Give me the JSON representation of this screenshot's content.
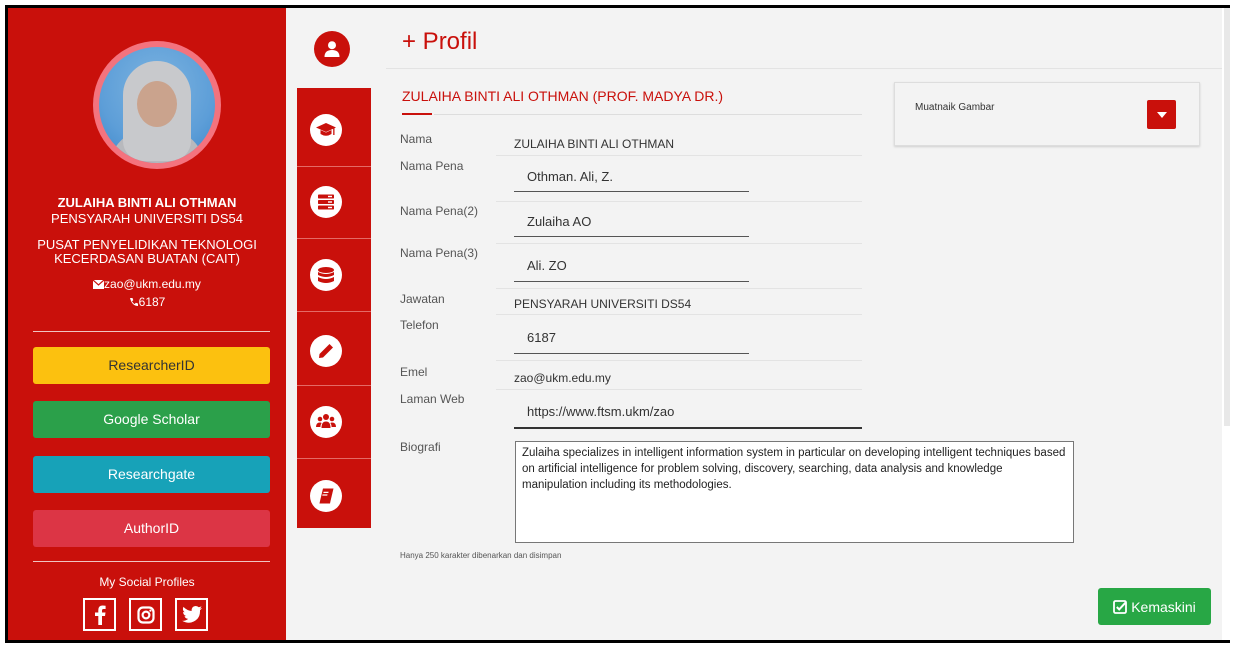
{
  "sidebar": {
    "full_name": "ZULAIHA BINTI ALI OTHMAN",
    "position": "PENSYARAH UNIVERSITI DS54",
    "dept_line1": "PUSAT PENYELIDIKAN TEKNOLOGI",
    "dept_line2": "KECERDASAN BUATAN (CAIT)",
    "email": "zao@ukm.edu.my",
    "phone": "6187",
    "buttons": {
      "researcherid": "ResearcherID",
      "google_scholar": "Google Scholar",
      "researchgate": "Researchgate",
      "authorid": "AuthorID"
    },
    "social_title": "My Social Profiles",
    "social_icons": [
      "facebook-icon",
      "instagram-icon",
      "twitter-icon"
    ]
  },
  "iconbar": [
    "user-icon",
    "graduation-cap-icon",
    "server-icon",
    "database-icon",
    "pencil-icon",
    "users-icon",
    "book-icon"
  ],
  "main": {
    "page_title": "+ Profil",
    "profile_heading": "ZULAIHA BINTI ALI OTHMAN  (PROF. MADYA DR.)",
    "fields": {
      "nama_label": "Nama",
      "nama_value": "ZULAIHA BINTI ALI OTHMAN",
      "nama_pena_label": "Nama Pena",
      "nama_pena_value": "Othman. Ali, Z.",
      "nama_pena2_label": "Nama Pena(2)",
      "nama_pena2_value": "Zulaiha AO",
      "nama_pena3_label": "Nama Pena(3)",
      "nama_pena3_value": "Ali. ZO",
      "jawatan_label": "Jawatan",
      "jawatan_value": "PENSYARAH UNIVERSITI DS54",
      "telefon_label": "Telefon",
      "telefon_value": "6187",
      "emel_label": "Emel",
      "emel_value": "zao@ukm.edu.my",
      "laman_web_label": "Laman Web",
      "laman_web_value": "https://www.ftsm.ukm/zao",
      "biografi_label": "Biografi",
      "biografi_value": "Zulaiha specializes in intelligent information system in particular on developing intelligent techniques based on artificial intelligence for problem solving, discovery, searching, data analysis and knowledge manipulation including its methodologies."
    },
    "bio_note": "Hanya 250 karakter dibenarkan dan disimpan",
    "upload_label": "Muatnaik Gambar",
    "save_label": "Kemaskini"
  },
  "colors": {
    "brand_red": "#c9100b",
    "researcherid": "#fcc10f",
    "google_scholar": "#2ba04a",
    "researchgate": "#17a2b8",
    "authorid": "#dc3545",
    "save": "#28a745"
  }
}
